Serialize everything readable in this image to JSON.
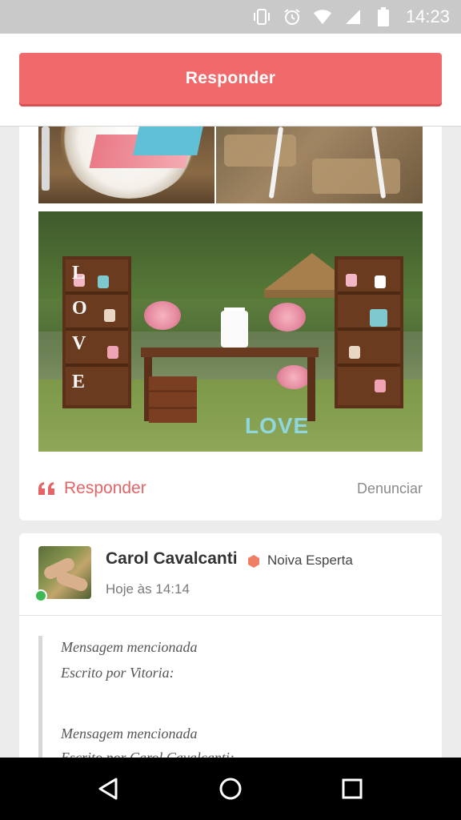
{
  "status_bar": {
    "time": "14:23",
    "icons": [
      "vibrate-icon",
      "alarm-icon",
      "wifi-icon",
      "signal-icon",
      "battery-icon"
    ]
  },
  "top_bar": {
    "reply_button_label": "Responder"
  },
  "post": {
    "image_top_left_alt": "table setting",
    "image_top_right_alt": "chair legs on stone",
    "image_main_alt": "wedding dessert table LOVE",
    "main_image_text": {
      "letters": [
        "L",
        "O",
        "V",
        "E"
      ],
      "sign": "LOVE"
    },
    "reply_label": "Responder",
    "report_label": "Denunciar"
  },
  "message": {
    "author": "Carol Cavalcanti",
    "badge": "Noiva Esperta",
    "timestamp": "Hoje às 14:14",
    "quote": {
      "lines": [
        "Mensagem mencionada",
        "Escrito por Vitoria:",
        "Mensagem mencionada",
        "Escrito por Carol Cavalcanti:"
      ]
    }
  },
  "colors": {
    "accent": "#f16a6b",
    "online": "#3dba56",
    "badge": "#f07e62"
  },
  "nav_bar": {
    "icons": [
      "back-icon",
      "home-icon",
      "recents-icon"
    ]
  }
}
